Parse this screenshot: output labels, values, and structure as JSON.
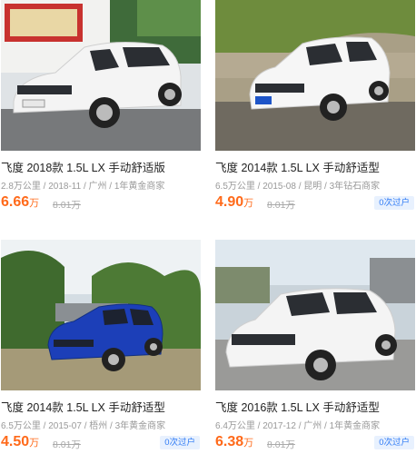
{
  "listings": [
    {
      "title": "飞度 2018款 1.5L LX 手动舒适版",
      "meta": "2.8万公里 / 2018-11 / 广州 / 1年黄金商家",
      "price": "6.66",
      "price_unit": "万",
      "original_price": "8.01万",
      "badge": "",
      "car_color": "#f4f4f4"
    },
    {
      "title": "飞度 2014款 1.5L LX 手动舒适型",
      "meta": "6.5万公里 / 2015-08 / 昆明 / 3年钻石商家",
      "price": "4.90",
      "price_unit": "万",
      "original_price": "8.01万",
      "badge": "0次过户",
      "car_color": "#f6f6f6"
    },
    {
      "title": "飞度 2014款 1.5L LX 手动舒适型",
      "meta": "6.5万公里 / 2015-07 / 梧州 / 3年黄金商家",
      "price": "4.50",
      "price_unit": "万",
      "original_price": "8.01万",
      "badge": "0次过户",
      "car_color": "#1c3fb8"
    },
    {
      "title": "飞度 2016款 1.5L LX 手动舒适型",
      "meta": "6.4万公里 / 2017-12 / 广州 / 1年黄金商家",
      "price": "6.38",
      "price_unit": "万",
      "original_price": "8.01万",
      "badge": "0次过户",
      "car_color": "#f4f4f4"
    }
  ],
  "colors": {
    "price": "#ff6a1a",
    "badge_text": "#2f7bf5",
    "badge_bg": "#e8f1fe"
  }
}
